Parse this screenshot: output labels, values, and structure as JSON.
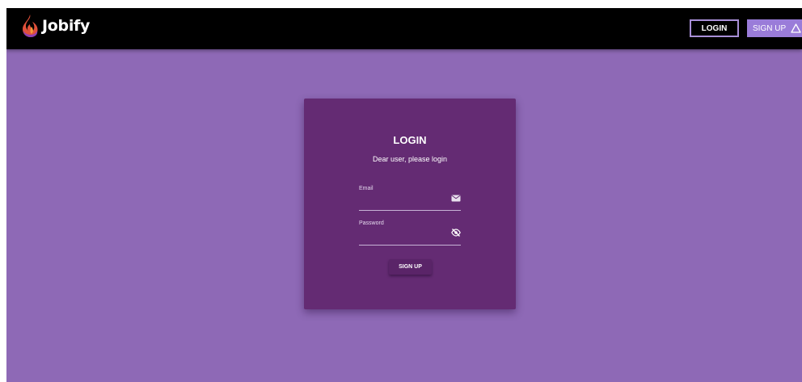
{
  "navbar": {
    "brand_name": "Jobify",
    "brand_logo_icon": "flame-icon",
    "login_label": "LOGIN",
    "signup_label": "SIGN UP",
    "signup_icon": "triangle-warning-icon"
  },
  "login_card": {
    "title": "LOGIN",
    "subtitle": "Dear user, please login",
    "email": {
      "label": "Email",
      "value": "",
      "icon": "envelope-icon"
    },
    "password": {
      "label": "Password",
      "value": "",
      "icon": "eye-off-icon"
    },
    "submit_label": "SIGN UP"
  },
  "colors": {
    "page_background": "#8e69b6",
    "navbar_background": "#000000",
    "card_background": "#642b73",
    "signup_nav_background": "#9a7cd9",
    "login_nav_border": "#a98fd8"
  }
}
